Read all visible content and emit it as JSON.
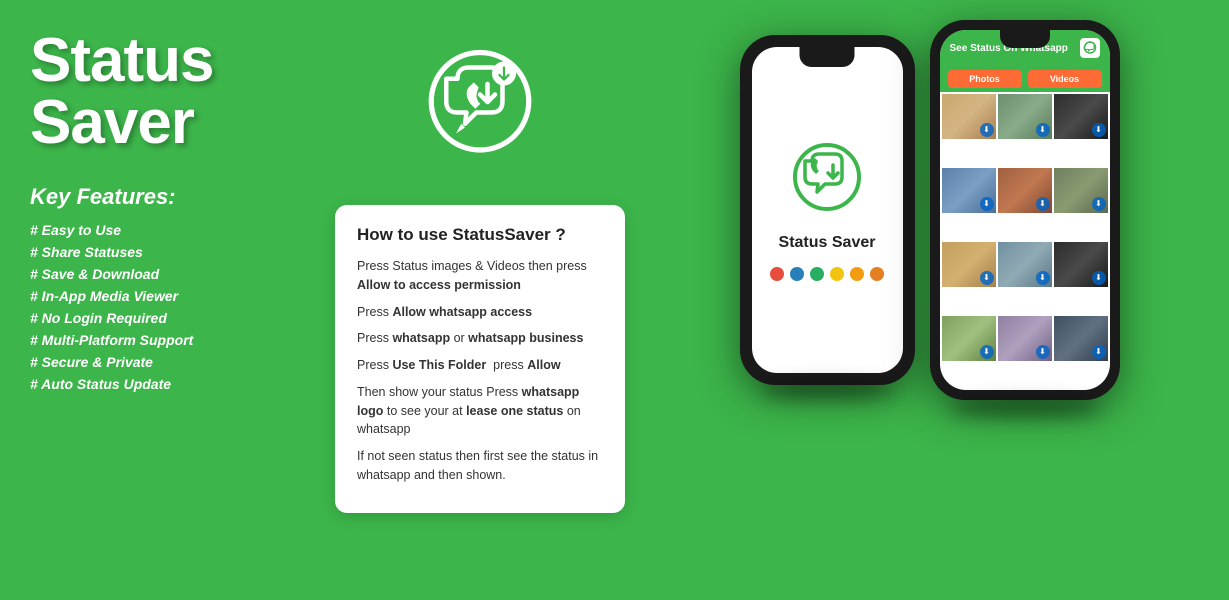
{
  "app": {
    "title": "Status Saver",
    "background_color": "#3cb54a"
  },
  "left": {
    "app_title": "Status Saver",
    "key_features_title": "Key Features:",
    "features": [
      "# Easy to Use",
      "# Share Statuses",
      "# Save & Download",
      "# In-App Media Viewer",
      "# No Login Required",
      "# Multi-Platform Support",
      "# Secure & Private",
      "# Auto Status Update"
    ]
  },
  "how_to_use": {
    "title": "How to use StatusSaver ?",
    "steps": [
      {
        "text": "Press Status images & Videos then press ",
        "bold": "Allow to access permission"
      },
      {
        "text": "Press ",
        "bold": "Allow whatsapp access"
      },
      {
        "text": "Press ",
        "bold": "whatsapp",
        "text2": " or ",
        "bold2": "whatsapp business"
      },
      {
        "text": "Press ",
        "bold": "Use This Folder",
        "text2": "  press ",
        "bold2": "Allow"
      },
      {
        "text": "Then show your status Press ",
        "bold": "whatsapp logo",
        "text2": " to see your at ",
        "bold2": "lease one status",
        "text3": " on whatsapp"
      },
      {
        "text": "If not seen status then first see the status in whatsapp and then shown."
      }
    ]
  },
  "phone1": {
    "app_name": "Status Saver",
    "dots": [
      "red",
      "blue",
      "green",
      "yellow",
      "yellow2",
      "orange"
    ]
  },
  "phone2": {
    "header_title": "See Status On Whatsapp",
    "tab_photos": "Photos",
    "tab_videos": "Videos"
  }
}
